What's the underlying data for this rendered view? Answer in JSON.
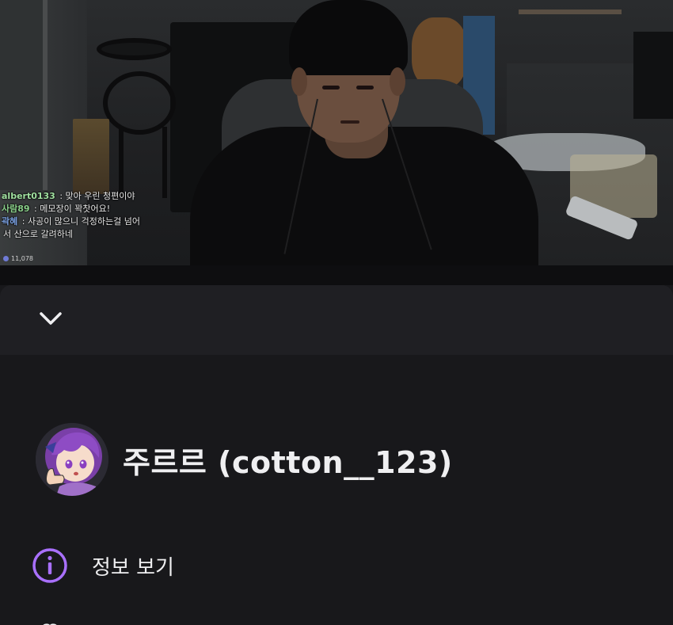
{
  "stream": {
    "chat": [
      {
        "user": "albert0133",
        "message": "맞아 우린 청편이야"
      },
      {
        "user": "사람89",
        "message": "메모장이 꽉찻어요!"
      },
      {
        "user": "곽혜",
        "message": "사공이 많으니 걱정하는걸 넘어",
        "continuation": "서 산으로 갈려하네"
      }
    ],
    "viewer_count": "11,078"
  },
  "sheet": {
    "collapse_icon": "chevron-down-icon",
    "profile": {
      "display_name": "주르르 (cotton__123)",
      "avatar_icon": "avatar-anime-girl"
    },
    "menu": [
      {
        "label": "정보 보기",
        "icon": "info-icon"
      },
      {
        "label": "",
        "icon": "more-icon"
      }
    ]
  },
  "colors": {
    "accent": "#a970ff",
    "background": "#18181b",
    "header": "#1f1f23",
    "text": "#efeff1"
  }
}
